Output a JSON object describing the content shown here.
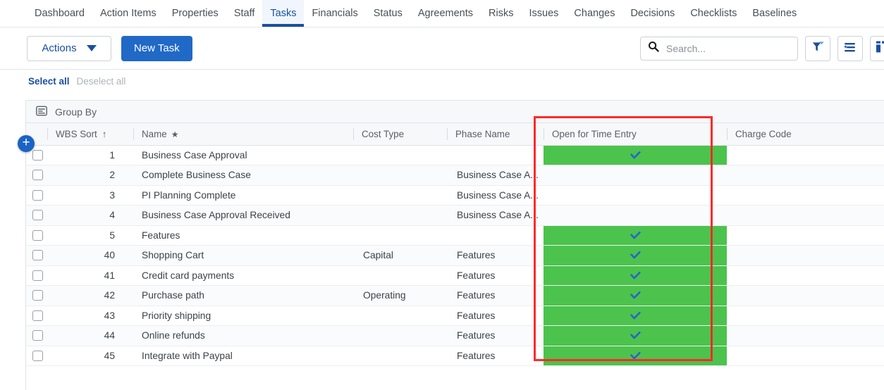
{
  "nav": {
    "tabs": [
      {
        "label": "Dashboard",
        "active": false
      },
      {
        "label": "Action Items",
        "active": false
      },
      {
        "label": "Properties",
        "active": false
      },
      {
        "label": "Staff",
        "active": false
      },
      {
        "label": "Tasks",
        "active": true
      },
      {
        "label": "Financials",
        "active": false
      },
      {
        "label": "Status",
        "active": false
      },
      {
        "label": "Agreements",
        "active": false
      },
      {
        "label": "Risks",
        "active": false
      },
      {
        "label": "Issues",
        "active": false
      },
      {
        "label": "Changes",
        "active": false
      },
      {
        "label": "Decisions",
        "active": false
      },
      {
        "label": "Checklists",
        "active": false
      },
      {
        "label": "Baselines",
        "active": false
      }
    ]
  },
  "toolbar": {
    "actions_label": "Actions",
    "new_task_label": "New Task",
    "search_placeholder": "Search...",
    "search_value": "",
    "icons": {
      "search": "search-icon",
      "filter": "filter-funnel-icon",
      "sort": "sort-list-icon",
      "columns": "columns-icon"
    }
  },
  "selection": {
    "select_all_label": "Select all",
    "deselect_all_label": "Deselect all"
  },
  "grid": {
    "group_by_label": "Group By",
    "group_by_icon": "list-card-icon",
    "add_row_label": "+",
    "columns": [
      {
        "key": "check",
        "label": ""
      },
      {
        "key": "wbs",
        "label": "WBS Sort",
        "sort_indicator": "↑"
      },
      {
        "key": "name",
        "label": "Name",
        "marker": "★"
      },
      {
        "key": "cost",
        "label": "Cost Type"
      },
      {
        "key": "phase",
        "label": "Phase Name"
      },
      {
        "key": "open",
        "label": "Open for Time Entry"
      },
      {
        "key": "charge",
        "label": "Charge Code"
      }
    ],
    "rows": [
      {
        "wbs": "1",
        "name": "Business Case Approval",
        "cost": "",
        "phase": "",
        "open": true,
        "charge": ""
      },
      {
        "wbs": "2",
        "name": "Complete Business Case",
        "cost": "",
        "phase": "Business Case A...",
        "open": false,
        "charge": ""
      },
      {
        "wbs": "3",
        "name": "PI Planning Complete",
        "cost": "",
        "phase": "Business Case A...",
        "open": false,
        "charge": ""
      },
      {
        "wbs": "4",
        "name": "Business Case Approval Received",
        "cost": "",
        "phase": "Business Case A...",
        "open": false,
        "charge": ""
      },
      {
        "wbs": "5",
        "name": "Features",
        "cost": "",
        "phase": "",
        "open": true,
        "charge": ""
      },
      {
        "wbs": "40",
        "name": "Shopping Cart",
        "cost": "Capital",
        "phase": "Features",
        "open": true,
        "charge": ""
      },
      {
        "wbs": "41",
        "name": "Credit card payments",
        "cost": "",
        "phase": "Features",
        "open": true,
        "charge": ""
      },
      {
        "wbs": "42",
        "name": "Purchase path",
        "cost": "Operating",
        "phase": "Features",
        "open": true,
        "charge": ""
      },
      {
        "wbs": "43",
        "name": "Priority shipping",
        "cost": "",
        "phase": "Features",
        "open": true,
        "charge": ""
      },
      {
        "wbs": "44",
        "name": "Online refunds",
        "cost": "",
        "phase": "Features",
        "open": true,
        "charge": ""
      },
      {
        "wbs": "45",
        "name": "Integrate with Paypal",
        "cost": "",
        "phase": "Features",
        "open": true,
        "charge": ""
      }
    ],
    "check_glyph": "✔"
  },
  "annotation": {
    "highlight_color": "#fc2a2a",
    "highlighted_column": "Open for Time Entry"
  },
  "colors": {
    "accent_blue": "#1a4fa0",
    "primary_button": "#2069c7",
    "open_green": "#4cc34c",
    "check_blue": "#2a64c8"
  }
}
